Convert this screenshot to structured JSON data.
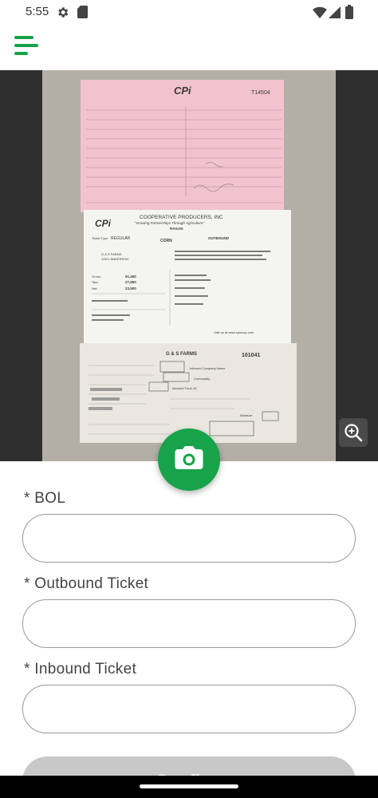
{
  "status_bar": {
    "time": "5:55",
    "icons": [
      "settings-gear-icon",
      "sim-card-icon",
      "wifi-icon",
      "cellular-signal-icon",
      "battery-icon"
    ]
  },
  "app_bar": {
    "menu_icon": "hamburger-menu-icon",
    "accent_color": "#16a34a"
  },
  "photo": {
    "pink_ticket": {
      "logo": "CPi",
      "number": "T14504"
    },
    "white_ticket": {
      "logo": "CPi",
      "company": "COOPERATIVE PRODUCERS, INC",
      "slogan": "\"Growing Partnerships Through Agriculture\"",
      "location": "RAGAN",
      "ticket_type_label": "Ticket Type",
      "ticket_type": "REGULAR",
      "commodity": "CORN",
      "outbound_label": "OUTBOUND",
      "farm": "G & S FARMS",
      "farm_contact": "JODY ANDERSON",
      "gross_label": "Gross:",
      "gross": "51,460",
      "tare_label": "Tare:",
      "tare": "27,960",
      "net_label": "Net:",
      "net": "23,500",
      "footer": "Visit us at www.cpicoop.com"
    },
    "yellow_ticket": {
      "farm": "G & S FARMS",
      "number": "101041",
      "inbound_company_label": "Inbound Company Name",
      "commodity_label": "Commodity",
      "truck_label": "Inbound Truck ID",
      "moisture_label": "Moisture"
    },
    "zoom_icon": "zoom-in-icon"
  },
  "camera_button": {
    "icon": "camera-icon"
  },
  "form": {
    "bol": {
      "label": "* BOL",
      "value": "",
      "placeholder": ""
    },
    "outbound_ticket": {
      "label": "* Outbound Ticket",
      "value": "",
      "placeholder": ""
    },
    "inbound_ticket": {
      "label": "* Inbound Ticket",
      "value": "",
      "placeholder": ""
    },
    "confirm_label": "Confirm"
  },
  "colors": {
    "primary": "#16a34a",
    "disabled_button": "#c8c8c8"
  }
}
